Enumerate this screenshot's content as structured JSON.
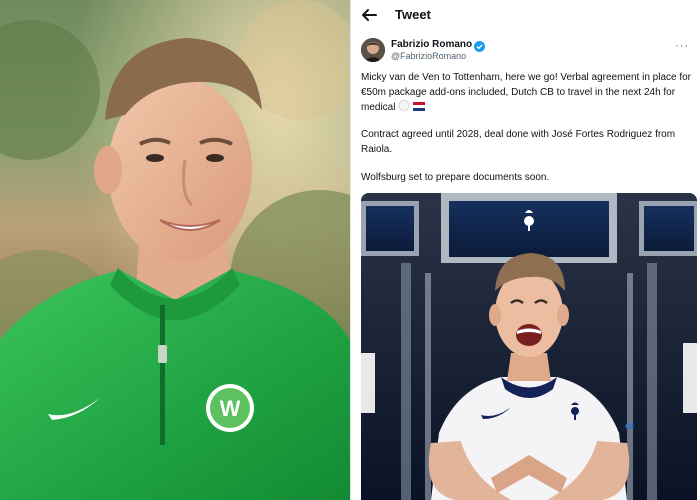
{
  "header": {
    "title": "Tweet"
  },
  "author": {
    "name": "Fabrizio Romano",
    "handle": "@FabrizioRomano"
  },
  "tweet": {
    "paragraph_1": "Micky van de Ven to Tottenham, here we go! Verbal agreement in place for €50m package add-ons included, Dutch CB to travel in the next 24h for medical",
    "paragraph_2": "Contract agreed until 2028, deal done with José Fortes Rodriguez from Raiola.",
    "paragraph_3": "Wolfsburg set to prepare documents soon."
  },
  "colors": {
    "verified": "#1d9bf0",
    "text_primary": "#0f1419",
    "text_secondary": "#536471",
    "wolfsburg_green": "#28a745",
    "tottenham_navy": "#132257"
  },
  "icons": {
    "back": "arrow-left",
    "verified": "checkmark-badge",
    "more": "horizontal-ellipsis",
    "flags": [
      "white-flag",
      "netherlands-flag"
    ]
  }
}
